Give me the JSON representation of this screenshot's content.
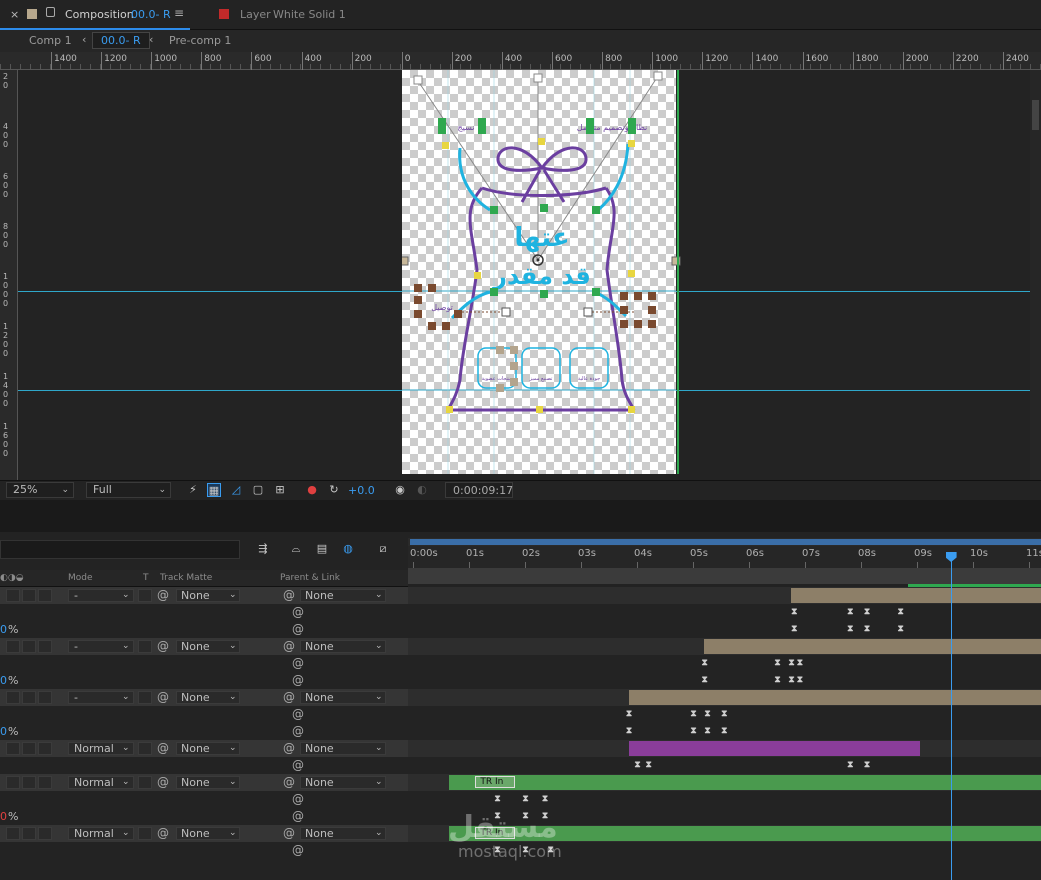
{
  "tabs": {
    "close": "×",
    "composition_label": "Composition",
    "composition_name": "00.0- R",
    "layer_label": "Layer",
    "layer_name": "White Solid 1"
  },
  "breadcrumbs": [
    "Comp 1",
    "00.0- R",
    "Pre-comp 1"
  ],
  "ruler_top": [
    "1400",
    "1200",
    "1000",
    "800",
    "600",
    "400",
    "200",
    "0",
    "200",
    "400",
    "600",
    "800",
    "1000",
    "1200",
    "1400",
    "1600",
    "1800",
    "2000",
    "2200",
    "2400"
  ],
  "ruler_left": [
    "2\n0",
    "4\n0\n0",
    "6\n0\n0",
    "8\n0\n0",
    "1\n0\n0\n0",
    "1\n2\n0\n0",
    "1\n4\n0\n0",
    "1\n6\n0\n0"
  ],
  "artwork": {
    "title_line1": "عتها",
    "title_line2": "قد مقدر",
    "label_top_left": "نسيج",
    "label_top_right": "نظام وتصميم متكامل",
    "label_left": "توصيل",
    "icon_labels": [
      "منتجات عضوية",
      "تصنيع مميز",
      "جودة عالية"
    ],
    "colors": {
      "purple": "#6b3fa0",
      "cyan": "#1fb3e0",
      "green": "#2fa84f",
      "brown": "#7a4a2f"
    }
  },
  "viewer_toolbar": {
    "zoom": "25%",
    "resolution": "Full",
    "exposure": "+0.0",
    "timecode": "0:00:09:17"
  },
  "timeline": {
    "columns": {
      "mode": "Mode",
      "t": "T",
      "track_matte": "Track Matte",
      "parent_link": "Parent & Link"
    },
    "ticks": [
      "0:00s",
      "01s",
      "02s",
      "03s",
      "04s",
      "05s",
      "06s",
      "07s",
      "08s",
      "09s",
      "10s",
      "11s"
    ],
    "playhead_seconds": 9.6,
    "layers": [
      {
        "mode": "-",
        "matte": "None",
        "parent": "None",
        "pct1": "0",
        "pct2": "0",
        "bar_start": 6.75,
        "bar_color": "#8d7f68",
        "keys_a": [
          6.8,
          7.8,
          8.1,
          8.7
        ],
        "keys_b": [
          6.8,
          7.8,
          8.1,
          8.7
        ]
      },
      {
        "mode": "-",
        "matte": "None",
        "parent": "None",
        "pct1": "0",
        "pct2": "0",
        "bar_start": 5.2,
        "bar_color": "#8d7f68",
        "keys_a": [
          5.2,
          6.5,
          6.75,
          6.9
        ],
        "keys_b": [
          5.2,
          6.5,
          6.75,
          6.9
        ]
      },
      {
        "mode": "-",
        "matte": "None",
        "parent": "None",
        "pct1": "0",
        "pct2": "0",
        "bar_start": 3.85,
        "bar_color": "#8d7f68",
        "keys_a": [
          3.85,
          5.0,
          5.25,
          5.55
        ],
        "keys_b": [
          3.85,
          5.0,
          5.25,
          5.55
        ]
      },
      {
        "mode": "Normal",
        "matte": "None",
        "parent": "None",
        "bar_start": 3.85,
        "bar_end": 9.05,
        "bar_color": "#8a3d9a",
        "keys_a": [
          4.0,
          4.2,
          7.8,
          8.1
        ]
      },
      {
        "mode": "Normal",
        "matte": "None",
        "parent": "None",
        "pct1": "0",
        "pct2": "0",
        "bar_start": 0.65,
        "bar_color": "#4a9a4e",
        "marker": "TR In",
        "keys_a": [
          1.5,
          2.0,
          2.35
        ],
        "keys_b": [
          1.5,
          2.0,
          2.35
        ]
      },
      {
        "mode": "Normal",
        "matte": "None",
        "parent": "None",
        "bar_start": 0.65,
        "bar_color": "#4a9a4e",
        "marker": "TR In",
        "keys_a": [
          1.5,
          2.0,
          2.45
        ]
      }
    ]
  },
  "watermark": {
    "brand": "مستقل",
    "url": "mostaql.com"
  }
}
